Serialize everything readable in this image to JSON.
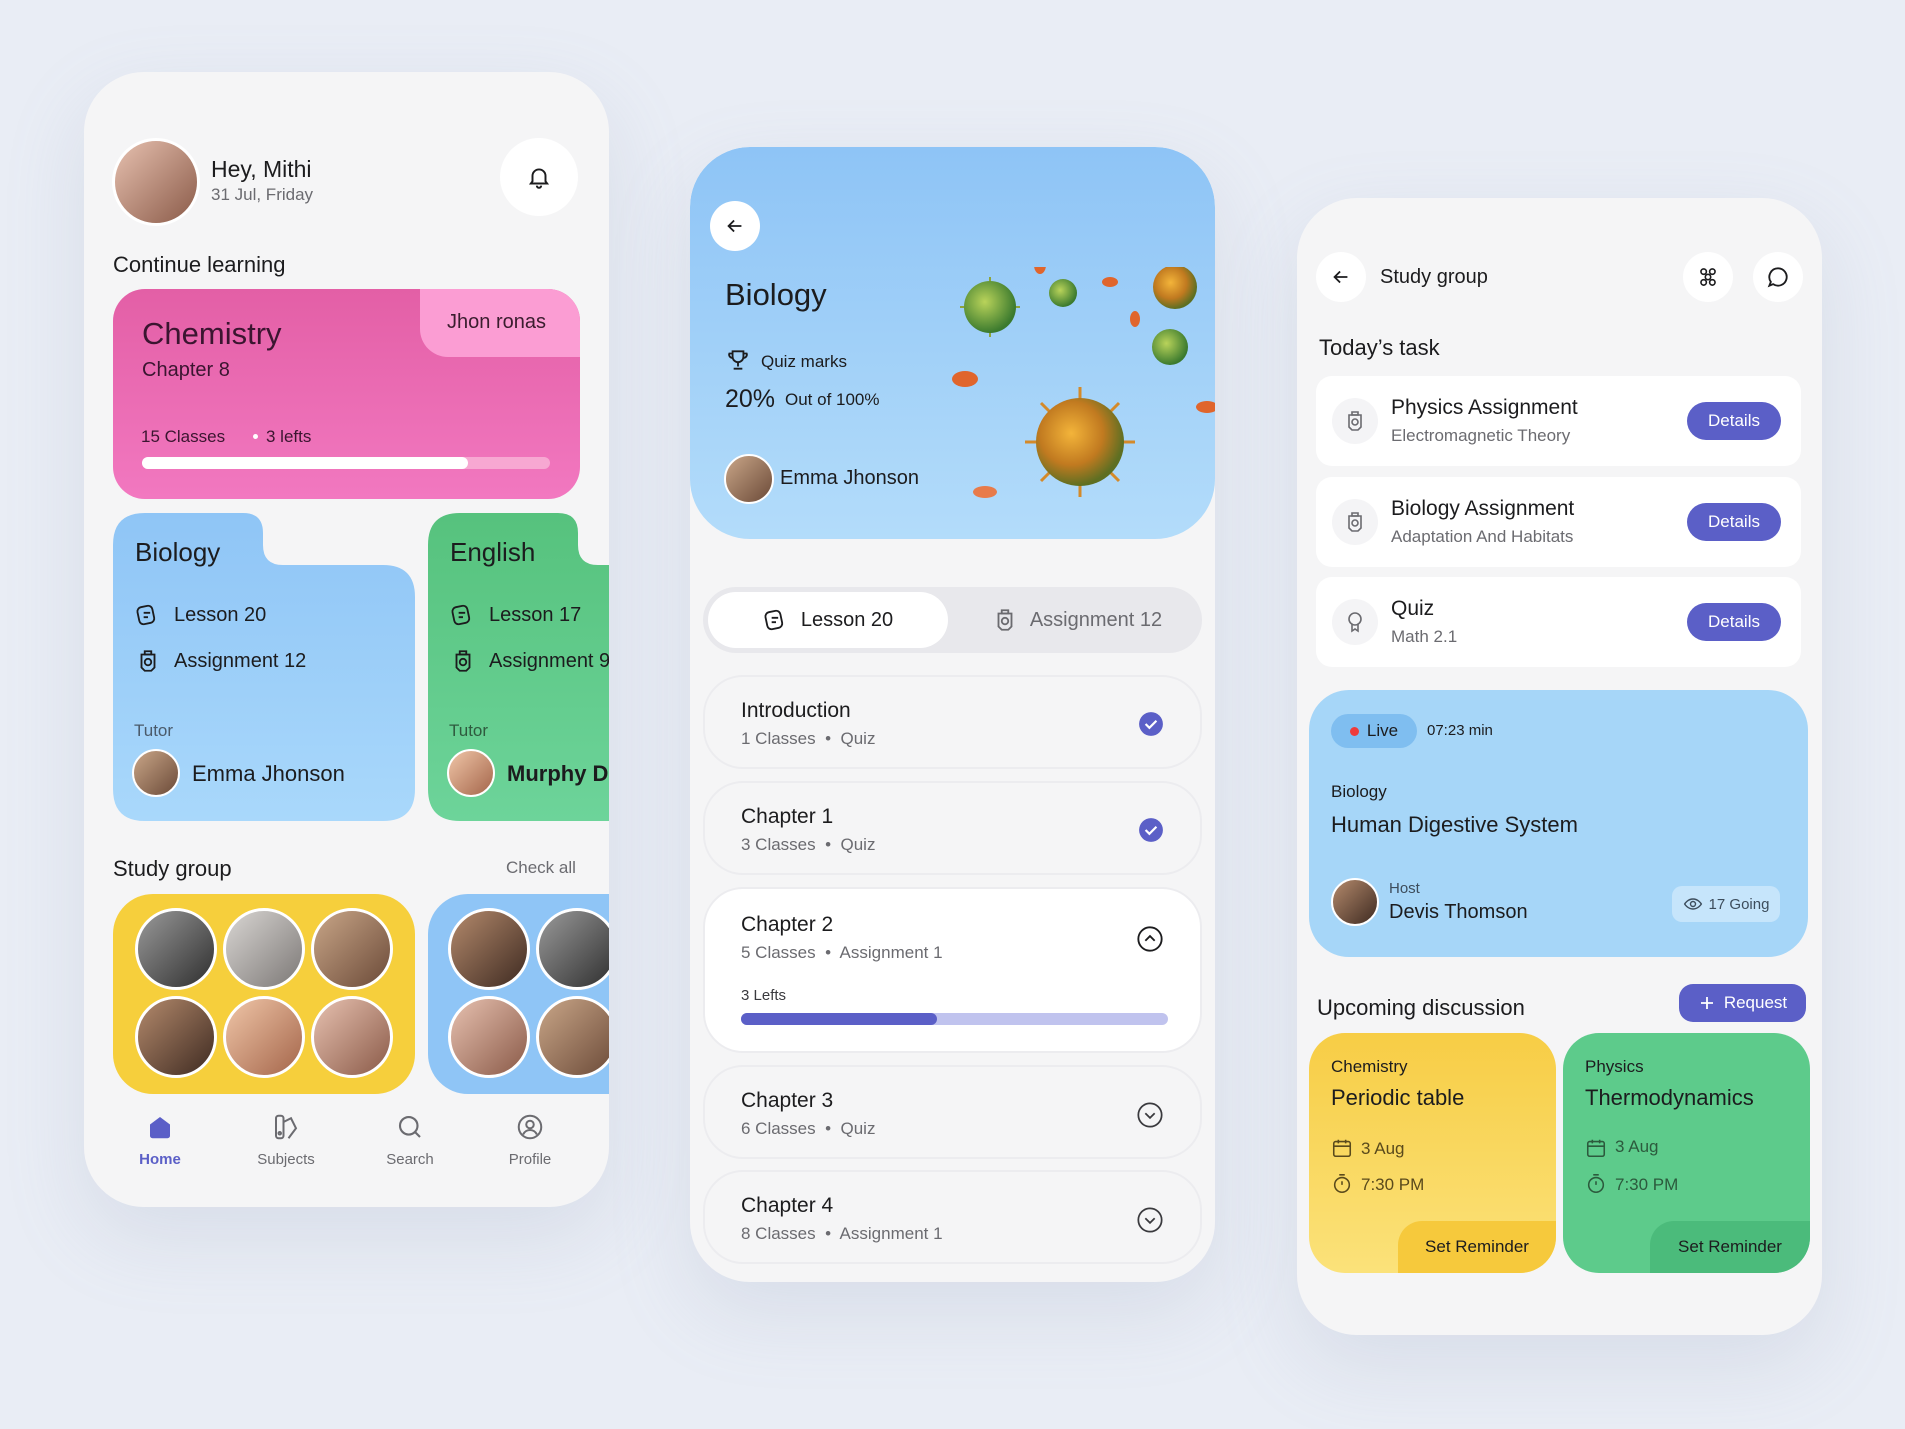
{
  "home": {
    "greeting": "Hey, Mithi",
    "date": "31 Jul, Friday",
    "continue_title": "Continue learning",
    "course": {
      "title": "Chemistry",
      "chapter": "Chapter 8",
      "tutor": "Jhon ronas",
      "classes": "15 Classes",
      "lefts": "3 lefts",
      "progress": 0.8
    },
    "cards": [
      {
        "title": "Biology",
        "lesson": "Lesson 20",
        "assignment": "Assignment 12",
        "tutor_label": "Tutor",
        "tutor": "Emma Jhonson"
      },
      {
        "title": "English",
        "lesson": "Lesson 17",
        "assignment": "Assignment 9",
        "tutor_label": "Tutor",
        "tutor": "Murphy D"
      }
    ],
    "study_group_title": "Study group",
    "check_all": "Check all",
    "nav": [
      {
        "label": "Home",
        "icon": "home-icon",
        "active": true
      },
      {
        "label": "Subjects",
        "icon": "subjects-icon"
      },
      {
        "label": "Search",
        "icon": "search-icon"
      },
      {
        "label": "Profile",
        "icon": "profile-icon"
      }
    ]
  },
  "subject": {
    "title": "Biology",
    "quiz_label": "Quiz marks",
    "percent": "20%",
    "percent_sub": "Out of 100%",
    "tutor": "Emma Jhonson",
    "tabs": [
      {
        "label": "Lesson 20"
      },
      {
        "label": "Assignment 12"
      }
    ],
    "chapters": [
      {
        "title": "Introduction",
        "classes": "1 Classes",
        "type": "Quiz",
        "state": "done"
      },
      {
        "title": "Chapter 1",
        "classes": "3 Classes",
        "type": "Quiz",
        "state": "done"
      },
      {
        "title": "Chapter 2",
        "classes": "5 Classes",
        "type": "Assignment 1",
        "state": "open",
        "lefts": "3 Lefts",
        "progress": 0.46
      },
      {
        "title": "Chapter 3",
        "classes": "6 Classes",
        "type": "Quiz",
        "state": "closed"
      },
      {
        "title": "Chapter 4",
        "classes": "8 Classes",
        "type": "Assignment 1",
        "state": "closed"
      }
    ]
  },
  "group": {
    "title": "Study group",
    "today_title": "Today’s task",
    "tasks": [
      {
        "title": "Physics Assignment",
        "sub": "Electromagnetic Theory",
        "action": "Details"
      },
      {
        "title": "Biology Assignment",
        "sub": "Adaptation And Habitats",
        "action": "Details"
      },
      {
        "title": "Quiz",
        "sub": "Math 2.1",
        "action": "Details"
      }
    ],
    "live": {
      "badge": "Live",
      "time": "07:23 min",
      "subject": "Biology",
      "topic": "Human Digestive System",
      "host_label": "Host",
      "host": "Devis Thomson",
      "going": "17 Going"
    },
    "upcoming_title": "Upcoming discussion",
    "request": "Request",
    "discussions": [
      {
        "subject": "Chemistry",
        "topic": "Periodic table",
        "date": "3 Aug",
        "time": "7:30 PM",
        "action": "Set Reminder"
      },
      {
        "subject": "Physics",
        "topic": "Thermodynamics",
        "date": "3 Aug",
        "time": "7:30 PM",
        "action": "Set Reminder"
      }
    ]
  },
  "colors": {
    "accent": "#5b5fc7",
    "pink": "#ee6fb6",
    "blue": "#91c7f7",
    "green": "#5dcb8b",
    "yellow": "#fbd64d"
  }
}
